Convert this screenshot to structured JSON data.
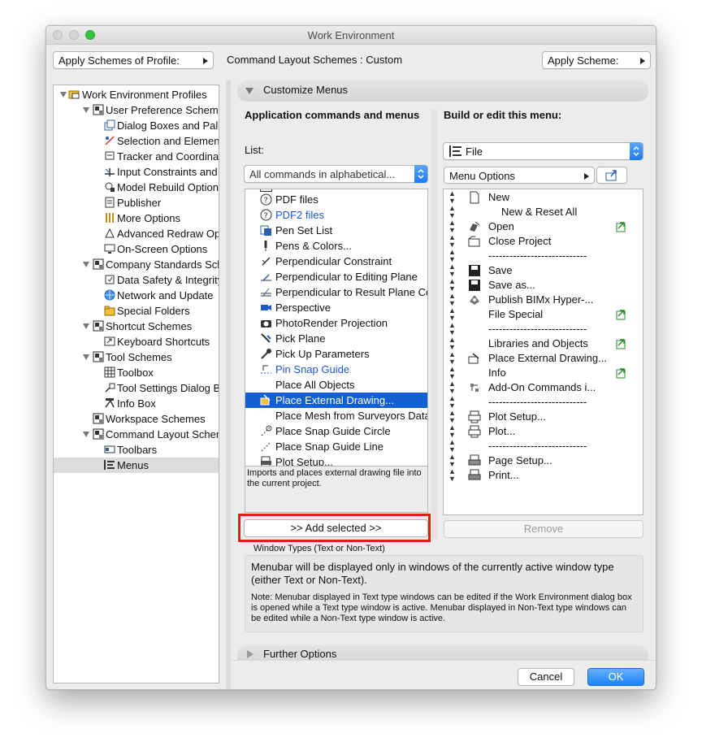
{
  "window": {
    "title": "Work Environment"
  },
  "toolbar": {
    "apply_profile_label": "Apply Schemes of Profile:",
    "command_layout_label": "Command Layout Schemes :",
    "command_layout_value": "Custom",
    "apply_scheme_label": "Apply Scheme:"
  },
  "tree": {
    "items": [
      {
        "label": "Work Environment Profiles"
      },
      {
        "label": "User Preference Schemes"
      },
      {
        "label": "Dialog Boxes and Palettes"
      },
      {
        "label": "Selection and Element Information"
      },
      {
        "label": "Tracker and Coordinate Input"
      },
      {
        "label": "Input Constraints and Guides"
      },
      {
        "label": "Model Rebuild Options"
      },
      {
        "label": "Publisher"
      },
      {
        "label": "More Options"
      },
      {
        "label": "Advanced Redraw Options"
      },
      {
        "label": "On-Screen Options"
      },
      {
        "label": "Company Standards Schemes"
      },
      {
        "label": "Data Safety & Integrity"
      },
      {
        "label": "Network and Update"
      },
      {
        "label": "Special Folders"
      },
      {
        "label": "Shortcut Schemes"
      },
      {
        "label": "Keyboard Shortcuts"
      },
      {
        "label": "Tool Schemes"
      },
      {
        "label": "Toolbox"
      },
      {
        "label": "Tool Settings Dialog Boxes"
      },
      {
        "label": "Info Box"
      },
      {
        "label": "Workspace Schemes"
      },
      {
        "label": "Command Layout Schemes"
      },
      {
        "label": "Toolbars"
      },
      {
        "label": "Menus"
      }
    ]
  },
  "customize": {
    "header": "Customize Menus",
    "left_title": "Application commands and menus",
    "right_title": "Build or edit this menu:",
    "list_label": "List:",
    "list_select": "All commands in alphabetical...",
    "menu_select": "File",
    "menu_options": "Menu Options",
    "commands": [
      {
        "label": "PDF files"
      },
      {
        "label": "PDF2 files"
      },
      {
        "label": "Pen Set List"
      },
      {
        "label": "Pens & Colors..."
      },
      {
        "label": "Perpendicular Constraint"
      },
      {
        "label": "Perpendicular to Editing Plane"
      },
      {
        "label": "Perpendicular to Result Plane Constraint"
      },
      {
        "label": "Perspective"
      },
      {
        "label": "PhotoRender Projection"
      },
      {
        "label": "Pick Plane"
      },
      {
        "label": "Pick Up Parameters"
      },
      {
        "label": "Pin Snap Guide"
      },
      {
        "label": "Place All Objects"
      },
      {
        "label": "Place External Drawing..."
      },
      {
        "label": "Place Mesh from Surveyors Data"
      },
      {
        "label": "Place Snap Guide Circle"
      },
      {
        "label": "Place Snap Guide Line"
      },
      {
        "label": "Plot Setup..."
      }
    ],
    "description": "Imports and places external drawing file into the current project.",
    "add_button": ">> Add selected >>",
    "remove_button": "Remove",
    "menu_items": [
      {
        "label": "New"
      },
      {
        "label": "New & Reset All"
      },
      {
        "label": "Open"
      },
      {
        "label": "Close Project"
      },
      {
        "label": "----------------------------"
      },
      {
        "label": "Save"
      },
      {
        "label": "Save as..."
      },
      {
        "label": "Publish BIMx Hyper-..."
      },
      {
        "label": "File Special"
      },
      {
        "label": "----------------------------"
      },
      {
        "label": "Libraries and Objects"
      },
      {
        "label": "Place External Drawing..."
      },
      {
        "label": "Info"
      },
      {
        "label": "Add-On Commands i..."
      },
      {
        "label": "----------------------------"
      },
      {
        "label": "Plot Setup..."
      },
      {
        "label": "Plot..."
      },
      {
        "label": "----------------------------"
      },
      {
        "label": "Page Setup..."
      },
      {
        "label": "Print..."
      }
    ],
    "window_types_label": "Window Types (Text or Non-Text)",
    "window_types_text": "Menubar will be displayed only in windows of the currently active window type (either Text or Non-Text).",
    "window_types_note": "Note: Menubar displayed in Text type windows can be edited if the Work Environment dialog box is opened while a Text type window is active. Menubar displayed in Non-Text type windows can be edited while a Non-Text type window is active."
  },
  "further_options": "Further Options",
  "buttons": {
    "cancel": "Cancel",
    "ok": "OK"
  },
  "colors": {
    "selection": "#1360d6",
    "highlight_box": "#e01e14",
    "link": "#1d57d6"
  }
}
